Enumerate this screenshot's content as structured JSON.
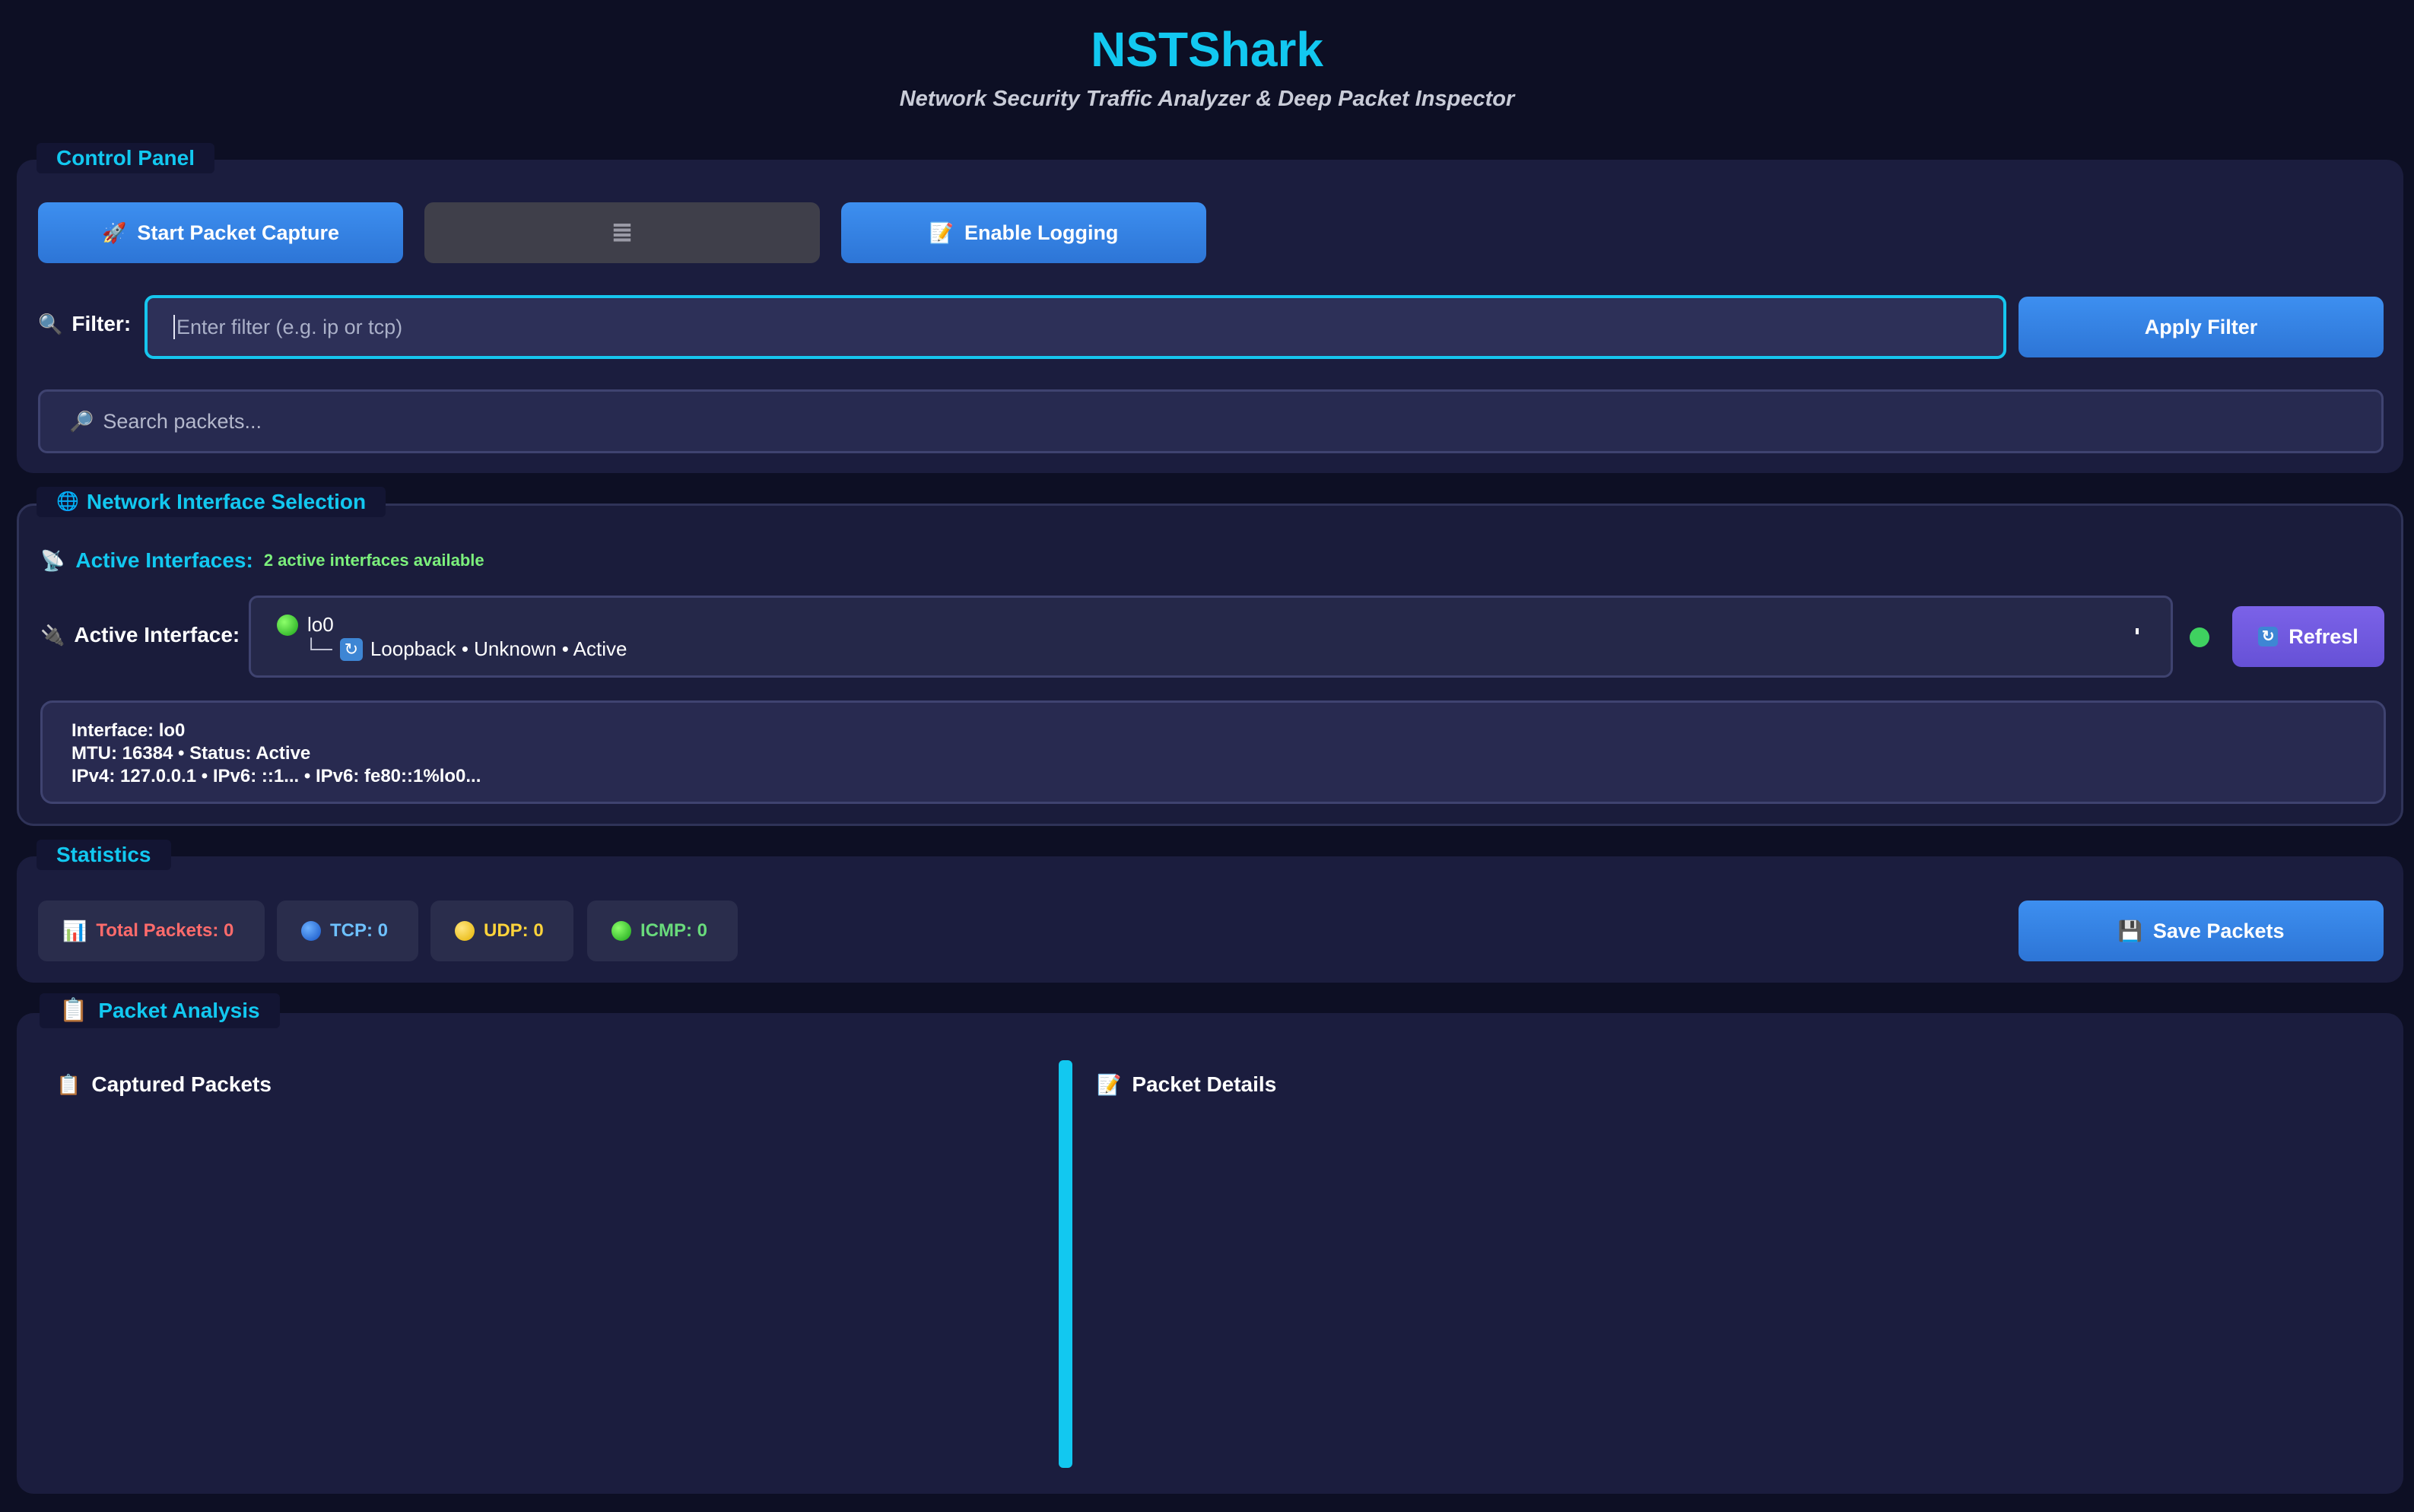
{
  "header": {
    "title": "NSTShark",
    "subtitle": "Network Security Traffic Analyzer & Deep Packet Inspector"
  },
  "control_panel": {
    "legend": "Control Panel",
    "start_capture_label": "Start Packet Capture",
    "stop_capture_icon": "≣",
    "enable_logging_label": "Enable Logging",
    "filter_label": "Filter:",
    "filter_placeholder": "Enter filter (e.g. ip or tcp)",
    "apply_filter_label": "Apply Filter",
    "search_placeholder": "Search packets..."
  },
  "interface_panel": {
    "legend": "Network Interface Selection",
    "active_interfaces_label": "Active Interfaces:",
    "active_interfaces_count": "2 active interfaces available",
    "active_interface_label": "Active Interface:",
    "selected_interface": {
      "name": "lo0",
      "tree_prefix": "└─",
      "description": "Loopback • Unknown • Active"
    },
    "refresh_label": "Refresl",
    "status_color": "#3fd160",
    "details": {
      "line1": "Interface: lo0",
      "line2": "MTU: 16384 • Status: Active",
      "line3": "IPv4: 127.0.0.1 • IPv6: ::1... • IPv6: fe80::1%lo0..."
    }
  },
  "statistics": {
    "legend": "Statistics",
    "total": "Total Packets: 0",
    "tcp": "TCP: 0",
    "udp": "UDP: 0",
    "icmp": "ICMP: 0",
    "save_label": "Save Packets"
  },
  "analysis": {
    "legend": "Packet Analysis",
    "captured_title": "Captured Packets",
    "details_title": "Packet Details"
  },
  "colors": {
    "accent": "#12c8f0",
    "button_blue": "#3d8ff0",
    "total_red": "#ff6b6b",
    "tcp_blue": "#6ec1ff",
    "udp_yellow": "#ffd43b",
    "icmp_green": "#69db7c"
  }
}
